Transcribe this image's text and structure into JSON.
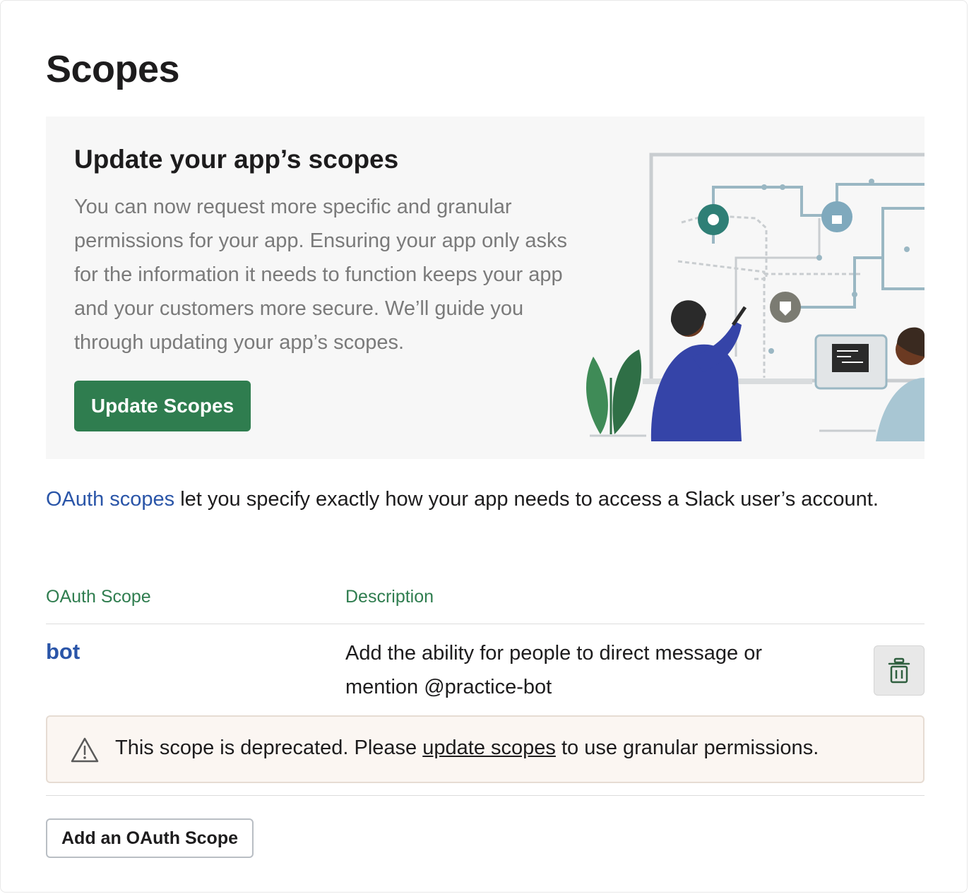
{
  "page": {
    "title": "Scopes"
  },
  "banner": {
    "heading": "Update your app’s scopes",
    "text": "You can now request more specific and granular permissions for your app. Ensuring your app only asks for the information it needs to function keeps your app and your customers more secure. We’ll guide you through updating your app’s scopes.",
    "button_label": "Update Scopes",
    "illustration_icon": "people-at-whiteboard-illustration"
  },
  "intro": {
    "link_text": "OAuth scopes",
    "rest_text": " let you specify exactly how your app needs to access a Slack user’s account."
  },
  "table": {
    "headers": {
      "scope": "OAuth Scope",
      "description": "Description"
    },
    "rows": [
      {
        "scope": "bot",
        "description": "Add the ability for people to direct message or mention @practice-bot",
        "delete_icon": "trash-icon"
      }
    ]
  },
  "warning": {
    "icon": "warning-triangle-icon",
    "text_before": "This scope is deprecated. Please ",
    "link_text": "update scopes",
    "text_after": " to use granular permissions."
  },
  "actions": {
    "add_label": "Add an OAuth Scope"
  },
  "colors": {
    "accent_green": "#2f7d4f",
    "link_blue": "#2a55a8",
    "warning_bg": "#fbf6f2"
  }
}
